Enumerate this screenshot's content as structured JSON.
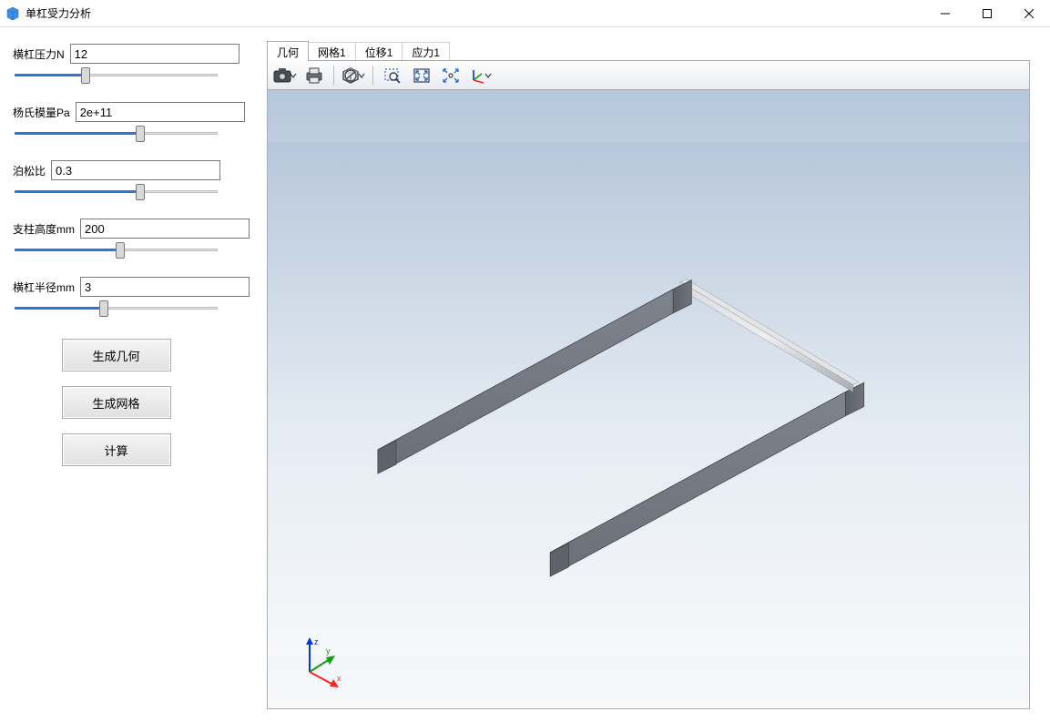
{
  "window": {
    "title": "单杠受力分析",
    "controls": {
      "minimize": "minimize",
      "maximize": "maximize",
      "close": "close"
    }
  },
  "sidebar": {
    "params": [
      {
        "label": "横杠压力N",
        "value": "12",
        "slider_pct": 35
      },
      {
        "label": "杨氏模量Pa",
        "value": "2e+11",
        "slider_pct": 62
      },
      {
        "label": "泊松比",
        "value": "0.3",
        "slider_pct": 62
      },
      {
        "label": "支柱高度mm",
        "value": "200",
        "slider_pct": 52
      },
      {
        "label": "横杠半径mm",
        "value": "3",
        "slider_pct": 44
      }
    ],
    "actions": [
      {
        "label": "生成几何"
      },
      {
        "label": "生成网格"
      },
      {
        "label": "计算"
      }
    ]
  },
  "main": {
    "tabs": [
      {
        "label": "几何",
        "active": true
      },
      {
        "label": "网格1",
        "active": false
      },
      {
        "label": "位移1",
        "active": false
      },
      {
        "label": "应力1",
        "active": false
      }
    ],
    "toolbar": {
      "items": [
        {
          "icon": "camera-icon",
          "dropdown": true
        },
        {
          "icon": "print-icon",
          "dropdown": false
        },
        {
          "separator": true
        },
        {
          "icon": "transparency-icon",
          "dropdown": true
        },
        {
          "separator": true
        },
        {
          "icon": "zoom-select-icon",
          "dropdown": false
        },
        {
          "icon": "zoom-extents-icon",
          "dropdown": false
        },
        {
          "icon": "zoom-fit-icon",
          "dropdown": false
        },
        {
          "icon": "axes-icon",
          "dropdown": true
        }
      ]
    },
    "viewport": {
      "axes": {
        "x": "x",
        "y": "y",
        "z": "z"
      },
      "model": "u-shaped-bar-geometry"
    }
  }
}
